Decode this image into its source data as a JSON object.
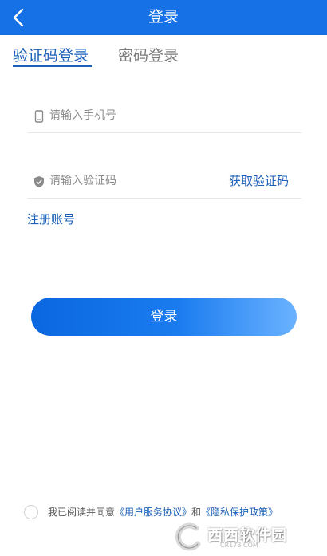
{
  "header": {
    "title": "登录",
    "back_icon": "chevron-left-icon"
  },
  "tabs": [
    {
      "label": "验证码登录",
      "active": true
    },
    {
      "label": "密码登录",
      "active": false
    }
  ],
  "form": {
    "phone": {
      "placeholder": "请输入手机号",
      "value": "",
      "icon": "phone-icon"
    },
    "code": {
      "placeholder": "请输入验证码",
      "value": "",
      "icon": "shield-icon"
    },
    "get_code_label": "获取验证码",
    "register_label": "注册账号"
  },
  "login_button_label": "登录",
  "agreement": {
    "checked": false,
    "prefix": "我已阅读并同意",
    "user_agreement": "《用户服务协议》",
    "and": "和",
    "privacy_policy": "《隐私保护政策》"
  },
  "watermark": {
    "brand": "西西软件园",
    "url": "CR173.COM"
  },
  "colors": {
    "header_bg": "#1671E6",
    "accent": "#1a5fb8",
    "button_start": "#0B67E0",
    "button_end": "#6AB2FF"
  }
}
